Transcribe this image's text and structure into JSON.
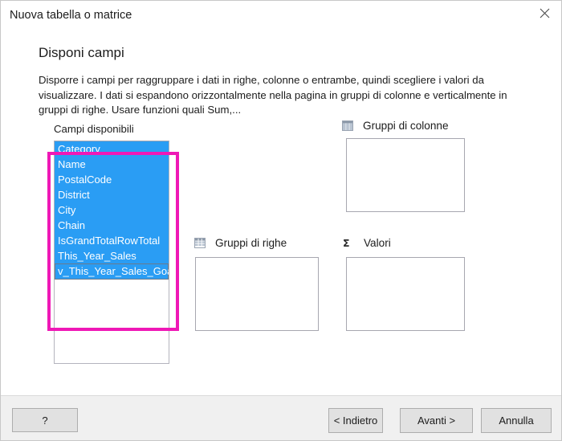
{
  "window": {
    "title": "Nuova tabella o matrice",
    "close_icon": "close-icon"
  },
  "page": {
    "heading": "Disponi campi",
    "description": "Disporre i campi per raggruppare i dati in righe, colonne o entrambe, quindi scegliere i valori da visualizzare. I dati si espandono orizzontalmente nella pagina in gruppi di colonne e verticalmente in gruppi di righe. Usare funzioni quali Sum,..."
  },
  "available_fields": {
    "label": "Campi disponibili",
    "items": [
      {
        "name": "Category",
        "selected": true,
        "focused": false
      },
      {
        "name": "Name",
        "selected": true,
        "focused": false
      },
      {
        "name": "PostalCode",
        "selected": true,
        "focused": false
      },
      {
        "name": "District",
        "selected": true,
        "focused": false
      },
      {
        "name": "City",
        "selected": true,
        "focused": false
      },
      {
        "name": "Chain",
        "selected": true,
        "focused": false
      },
      {
        "name": "IsGrandTotalRowTotal",
        "selected": true,
        "focused": false
      },
      {
        "name": "This_Year_Sales",
        "selected": true,
        "focused": false
      },
      {
        "name": "v_This_Year_Sales_Goal",
        "selected": true,
        "focused": true
      }
    ]
  },
  "highlight": {
    "color": "#ef18b6"
  },
  "zones": {
    "column_groups": {
      "label": "Gruppi di colonne",
      "icon": "column-groups-icon",
      "items": []
    },
    "row_groups": {
      "label": "Gruppi di righe",
      "icon": "row-groups-icon",
      "items": []
    },
    "values": {
      "label": "Valori",
      "icon": "sigma-icon",
      "glyph": "Σ",
      "items": []
    }
  },
  "footer": {
    "help_label": "?",
    "back_label": "< Indietro",
    "next_label": "Avanti >",
    "cancel_label": "Annulla"
  },
  "colors": {
    "selection_blue": "#2a9df4",
    "highlight_pink": "#ef18b6",
    "footer_bg": "#f0f0f0",
    "button_bg": "#e1e1e1"
  }
}
